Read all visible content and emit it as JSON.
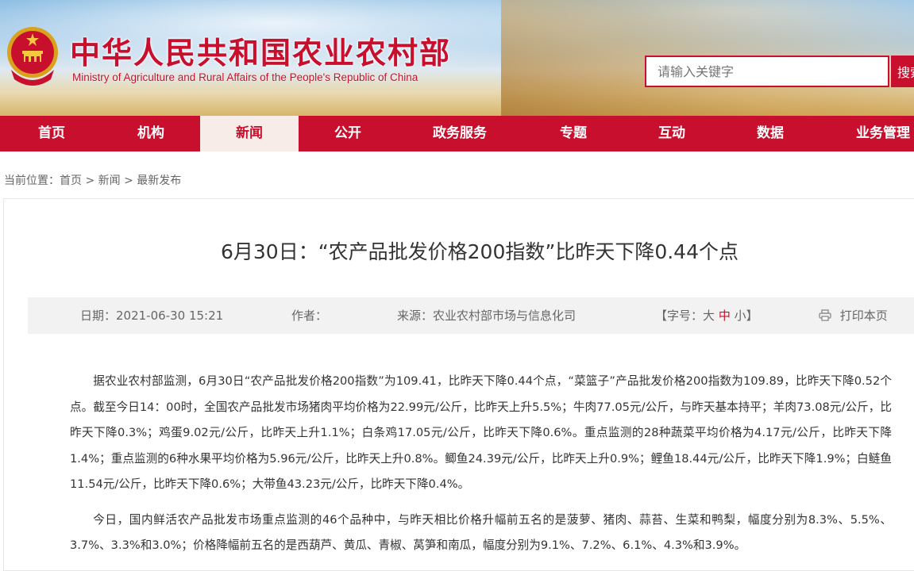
{
  "header": {
    "site_title": "中华人民共和国农业农村部",
    "site_subtitle": "Ministry of Agriculture and Rural Affairs of the People's Republic of China",
    "search_placeholder": "请输入关键字",
    "search_button": "搜索"
  },
  "nav": {
    "items": [
      {
        "label": "首页"
      },
      {
        "label": "机构"
      },
      {
        "label": "新闻",
        "active": true
      },
      {
        "label": "公开"
      },
      {
        "label": "政务服务"
      },
      {
        "label": "专题"
      },
      {
        "label": "互动"
      },
      {
        "label": "数据"
      },
      {
        "label": "业务管理"
      }
    ]
  },
  "breadcrumb": "当前位置：首页 > 新闻 > 最新发布",
  "article": {
    "title": "6月30日：“农产品批发价格200指数”比昨天下降0.44个点",
    "date": "日期：2021-06-30 15:21",
    "author": "作者：",
    "source": "来源：农业农村部市场与信息化司",
    "font_size_prefix": "【字号：",
    "font_large": "大",
    "font_medium": "中",
    "font_small": "小",
    "font_size_suffix": "】",
    "print": "打印本页",
    "paragraphs": [
      "据农业农村部监测，6月30日“农产品批发价格200指数”为109.41，比昨天下降0.44个点，“菜篮子”产品批发价格200指数为109.89，比昨天下降0.52个点。截至今日14：00时，全国农产品批发市场猪肉平均价格为22.99元/公斤，比昨天上升5.5%；牛肉77.05元/公斤，与昨天基本持平；羊肉73.08元/公斤，比昨天下降0.3%；鸡蛋9.02元/公斤，比昨天上升1.1%；白条鸡17.05元/公斤，比昨天下降0.6%。重点监测的28种蔬菜平均价格为4.17元/公斤，比昨天下降1.4%；重点监测的6种水果平均价格为5.96元/公斤，比昨天上升0.8%。鲫鱼24.39元/公斤，比昨天上升0.9%；鲤鱼18.44元/公斤，比昨天下降1.9%；白鲢鱼11.54元/公斤，比昨天下降0.6%；大带鱼43.23元/公斤，比昨天下降0.4%。",
      "今日，国内鲜活农产品批发市场重点监测的46个品种中，与昨天相比价格升幅前五名的是菠萝、猪肉、蒜苔、生菜和鸭梨，幅度分别为8.3%、5.5%、3.7%、3.3%和3.0%；价格降幅前五名的是西葫芦、黄瓜、青椒、莴笋和南瓜，幅度分别为9.1%、7.2%、6.1%、4.3%和3.9%。"
    ]
  },
  "colors": {
    "brand_red": "#c8102e",
    "active_nav_bg": "#f7ece8"
  }
}
